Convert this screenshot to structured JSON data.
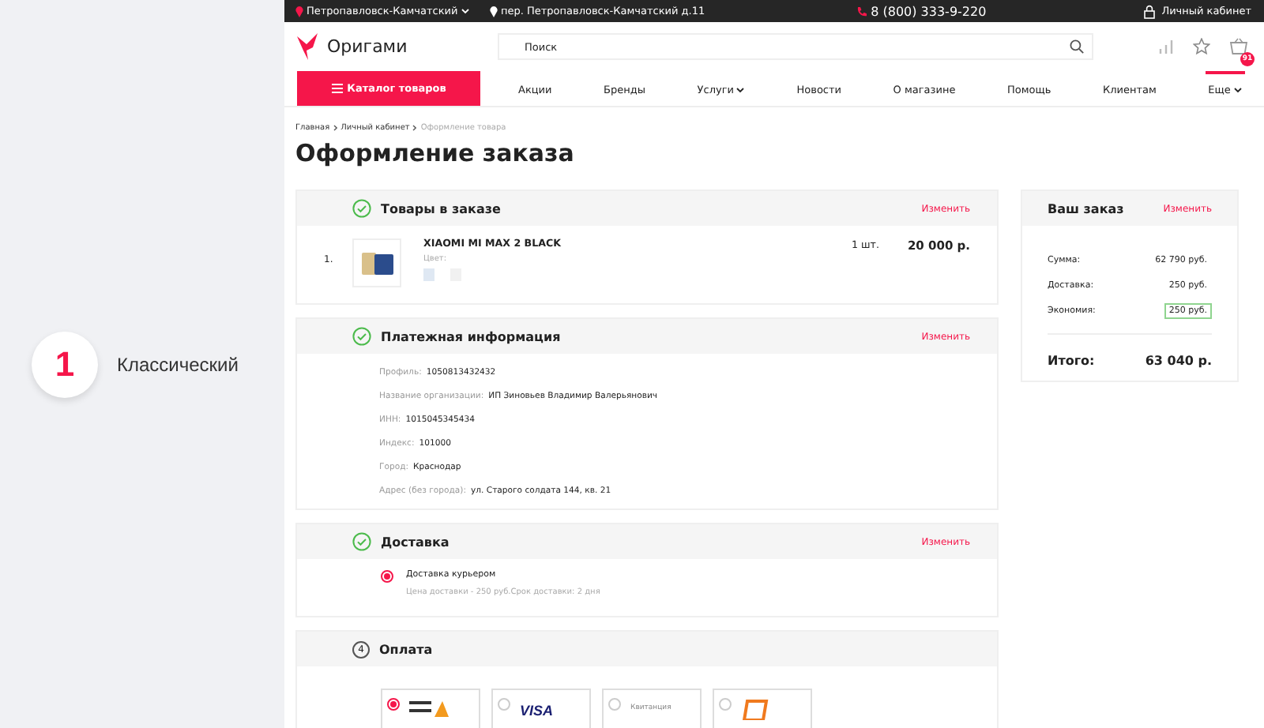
{
  "showcase": {
    "number": "1",
    "label": "Классический"
  },
  "top_bar": {
    "city": "Петропавловск-Камчатский",
    "address": "пер. Петропавловск-Камчатский д.11",
    "phone": "8 (800) 333-9-220",
    "account": "Личный кабинет"
  },
  "header": {
    "logo": "Оригами",
    "search": {
      "placeholder": "Поиск"
    },
    "cart_count": "91"
  },
  "nav": {
    "catalog": "Каталог товаров",
    "items": [
      {
        "label": "Акции",
        "dropdown": false,
        "selected": false
      },
      {
        "label": "Бренды",
        "dropdown": false,
        "selected": false
      },
      {
        "label": "Услуги",
        "dropdown": true,
        "selected": false
      },
      {
        "label": "Новости",
        "dropdown": false,
        "selected": false
      },
      {
        "label": "О магазине",
        "dropdown": false,
        "selected": false
      },
      {
        "label": "Помощь",
        "dropdown": false,
        "selected": false
      },
      {
        "label": "Клиентам",
        "dropdown": false,
        "selected": false
      },
      {
        "label": "Еще",
        "dropdown": true,
        "selected": true
      }
    ]
  },
  "breadcrumbs": [
    {
      "label": "Главная",
      "current": false
    },
    {
      "label": "Личный кабинет",
      "current": false
    },
    {
      "label": "Оформление товара",
      "current": true
    }
  ],
  "title": "Оформление заказа",
  "sections": [
    {
      "kind": "products",
      "title": "Товары в заказе",
      "done": true,
      "edit": "Изменить",
      "items": [
        {
          "index": "1.",
          "name": "XIAOMI MI MAX 2 BLACK",
          "color_label": "Цвет:",
          "qty": "1 шт.",
          "price": "20 000 р."
        }
      ]
    },
    {
      "kind": "fields",
      "title": "Платежная информация",
      "done": true,
      "edit": "Изменить",
      "fields": [
        {
          "label": "Профиль:",
          "value": "1050813432432"
        },
        {
          "label": "Название организации:",
          "value": "ИП Зиновьев Владимир Валерьянович"
        },
        {
          "label": "ИНН:",
          "value": "1015045345434"
        },
        {
          "label": "Индекс:",
          "value": "101000"
        },
        {
          "label": "Город:",
          "value": "Краснодар"
        },
        {
          "label": "Адрес (без города):",
          "value": "ул. Старого солдата 144, кв. 21"
        }
      ]
    },
    {
      "kind": "delivery",
      "title": "Доставка",
      "done": true,
      "edit": "Изменить",
      "options": [
        {
          "label": "Доставка курьером",
          "note": "Цена доставки - 250 руб.Срок доставки: 2 дня",
          "selected": true
        }
      ]
    },
    {
      "kind": "payment",
      "title": "Оплата",
      "done": false,
      "number": "4",
      "options": [
        {
          "kind": "wallet",
          "selected": true
        },
        {
          "kind": "visa",
          "label": "VISA",
          "selected": false
        },
        {
          "kind": "receipt",
          "label": "Квитанция",
          "selected": false
        },
        {
          "kind": "terminal",
          "selected": false
        }
      ]
    }
  ],
  "summary": {
    "title": "Ваш заказ",
    "edit": "Изменить",
    "rows": [
      {
        "label": "Сумма:",
        "value": "62 790 руб.",
        "highlighted": false
      },
      {
        "label": "Доставка:",
        "value": "250 руб.",
        "highlighted": false
      },
      {
        "label": "Экономия:",
        "value": "250 руб.",
        "highlighted": true
      }
    ],
    "total_label": "Итого:",
    "total_value": "63 040 р."
  }
}
